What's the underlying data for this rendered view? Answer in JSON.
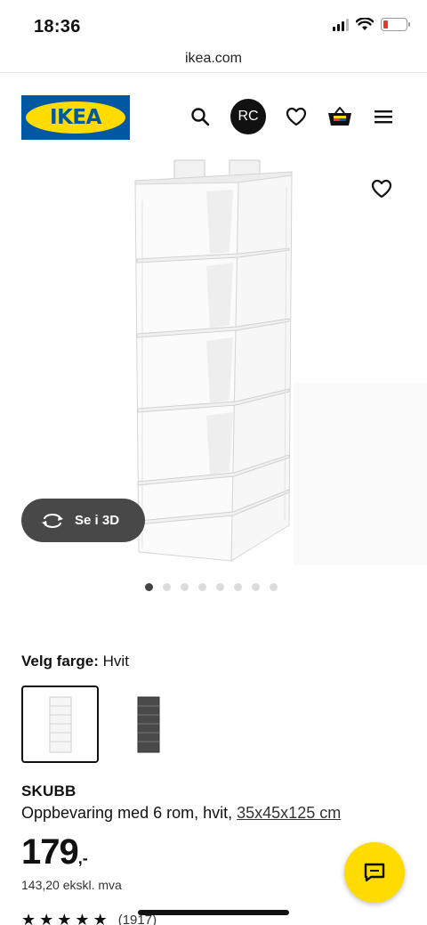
{
  "status_bar": {
    "time": "18:36"
  },
  "browser": {
    "url": "ikea.com"
  },
  "header": {
    "logo_text": "IKEA",
    "avatar_initials": "RC",
    "icons": [
      "search-icon",
      "avatar",
      "heart-icon",
      "basket-icon",
      "menu-icon"
    ]
  },
  "gallery": {
    "view_3d_label": "Se i 3D",
    "image_count": 8,
    "active_index": 0
  },
  "color": {
    "label": "Velg farge:",
    "value": "Hvit",
    "options": [
      "white",
      "dark-grey"
    ],
    "selected": "white"
  },
  "product": {
    "name": "SKUBB",
    "description": "Oppbevaring med 6 rom, hvit,",
    "measure": "35x45x125 cm",
    "price_main": "179",
    "price_suffix": ",-",
    "price_ex_vat": "143,20 ekskl. mva",
    "rating_stars": 5,
    "rating_count": "(1917)"
  },
  "colors": {
    "brand_blue": "#0058a3",
    "brand_yellow": "#ffdb00",
    "pill_grey": "#484848"
  }
}
